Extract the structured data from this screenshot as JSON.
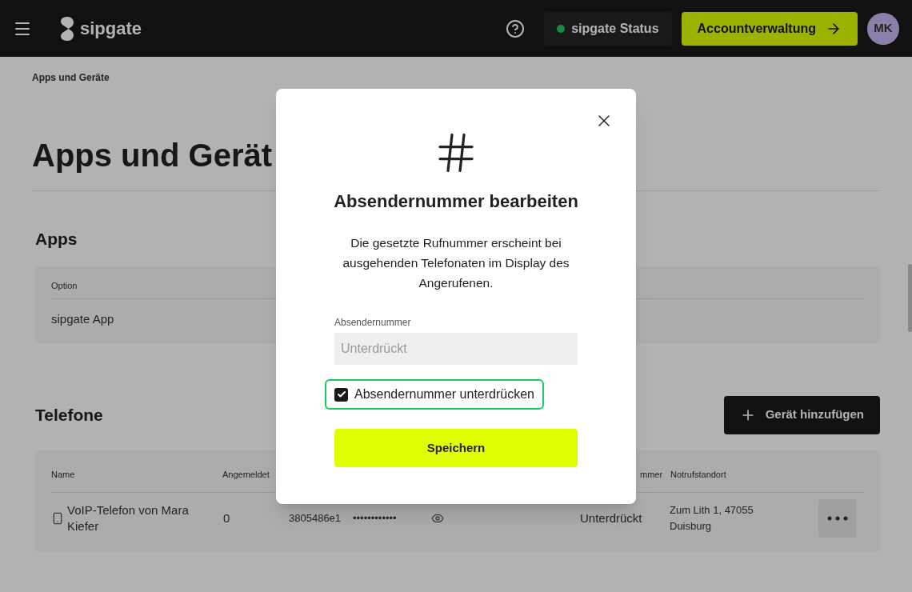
{
  "header": {
    "logo": "sipgate",
    "status_button": "sipgate Status",
    "account_button": "Accountverwaltung",
    "avatar": "MK"
  },
  "breadcrumb": "Apps und Geräte",
  "page_title": "Apps und Gerät",
  "apps": {
    "heading": "Apps",
    "column": "Option",
    "row": "sipgate App"
  },
  "phones": {
    "heading": "Telefone",
    "add_button": "Gerät hinzufügen",
    "columns": [
      "Name",
      "Angemeldet"
    ],
    "column_cut": "mmer",
    "column_last": "Notrufstandort",
    "row": {
      "name": "VoIP-Telefon von Mara Kiefer",
      "registered": "0",
      "id": "3805486e1",
      "password": "••••••••••••",
      "caller_id": "Unterdrückt",
      "location": "Zum Lith 1, 47055 Duisburg"
    }
  },
  "dialog": {
    "title": "Absendernummer bearbeiten",
    "text": "Die gesetzte Rufnummer erscheint bei ausgehenden Telefonaten im Display des Angerufenen.",
    "field_label": "Absendernummer",
    "field_placeholder": "Unterdrückt",
    "field_disabled": true,
    "checkbox_label": "Absendernummer unterdrücken",
    "checkbox_checked": true,
    "checkbox_focused": true,
    "save_button": "Speichern"
  }
}
